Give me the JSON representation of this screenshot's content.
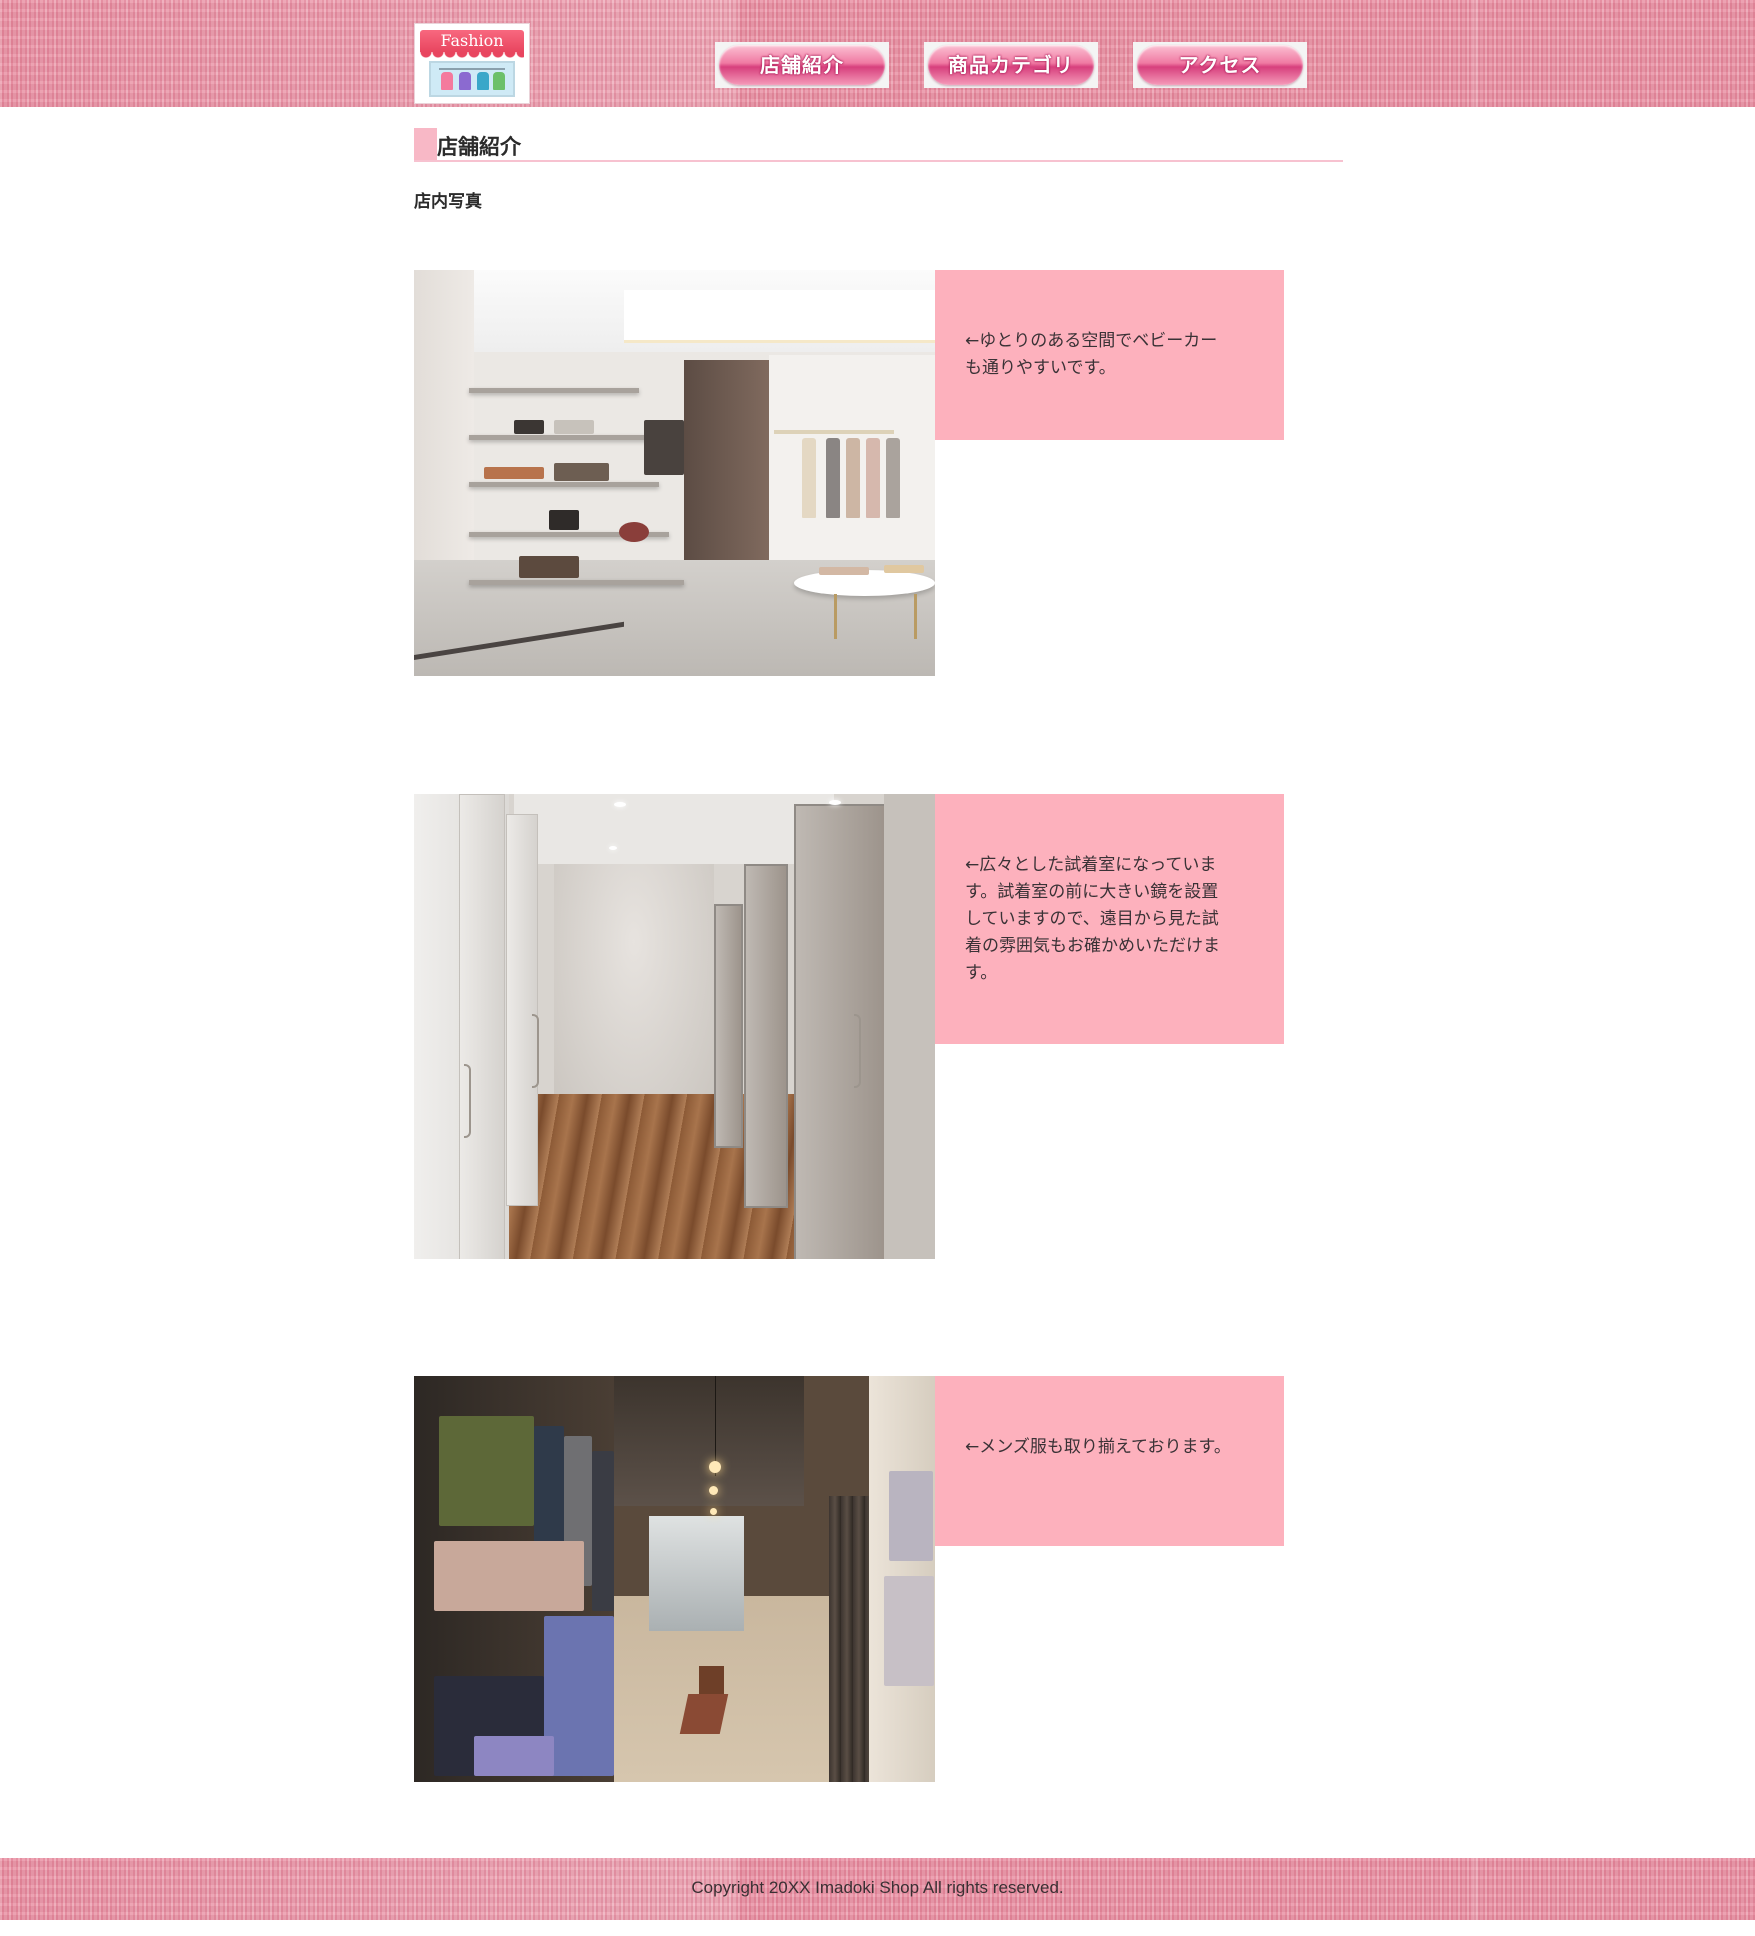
{
  "header": {
    "logo_text": "Fashion",
    "nav": [
      {
        "label": "店舗紹介"
      },
      {
        "label": "商品カテゴリ"
      },
      {
        "label": "アクセス"
      }
    ]
  },
  "main": {
    "section_title": "店舗紹介",
    "subtitle": "店内写真",
    "photos": [
      {
        "caption": "←ゆとりのある空間でベビーカーも通りやすいです。"
      },
      {
        "caption": "←広々とした試着室になっています。試着室の前に大きい鏡を設置していますので、遠目から見た試着の雰囲気もお確かめいただけます。"
      },
      {
        "caption": "←メンズ服も取り揃えております。"
      }
    ]
  },
  "footer": {
    "copyright": "Copyright 20XX Imadoki Shop All rights reserved."
  },
  "colors": {
    "header_band": "#e98fa2",
    "caption_bg": "#fdb1bd",
    "heading_accent": "#f8b8c6",
    "nav_button": "#f07aa3"
  }
}
